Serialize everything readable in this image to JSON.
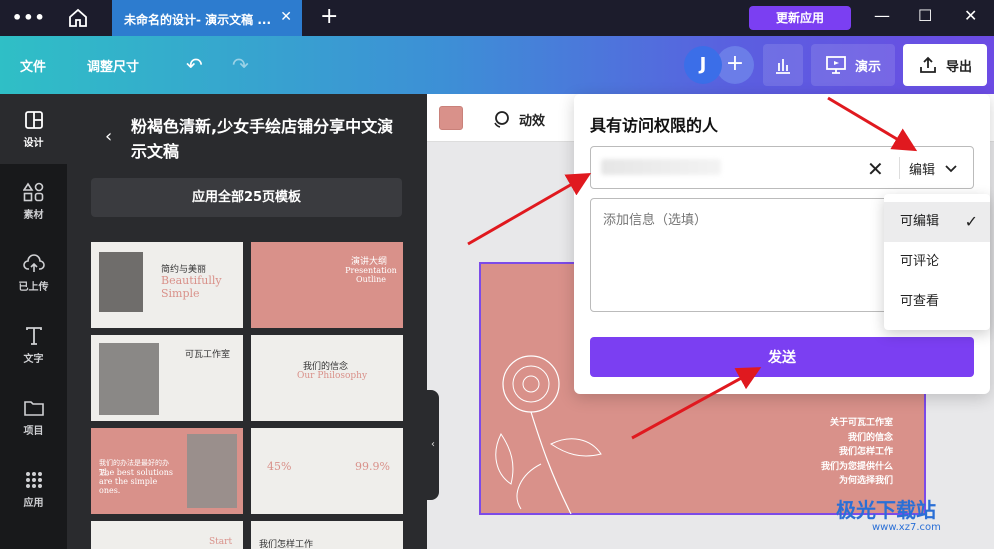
{
  "titlebar": {
    "tab_title": "未命名的设计- 演示文稿 ...",
    "update_label": "更新应用"
  },
  "toolbar": {
    "file_label": "文件",
    "resize_label": "调整尺寸",
    "avatar_initial": "J",
    "present_label": "演示",
    "export_label": "导出"
  },
  "leftnav": {
    "items": [
      {
        "label": "设计",
        "icon": "layout-icon"
      },
      {
        "label": "素材",
        "icon": "shapes-icon"
      },
      {
        "label": "已上传",
        "icon": "upload-icon"
      },
      {
        "label": "文字",
        "icon": "text-icon"
      },
      {
        "label": "项目",
        "icon": "folder-icon"
      },
      {
        "label": "应用",
        "icon": "apps-icon"
      }
    ]
  },
  "panel": {
    "title": "粉褐色清新,少女手绘店铺分享中文演示文稿",
    "apply_all_label": "应用全部25页模板",
    "thumbs": [
      {
        "t1": "简约与美丽",
        "t2": "Beautifully Simple"
      },
      {
        "t1": "演讲大纲",
        "t2": "Presentation Outline"
      },
      {
        "t1": "可瓦工作室",
        "t2": ""
      },
      {
        "t1": "我们的信念",
        "t2": "Our Philosophy"
      },
      {
        "t1": "我们的办法是最好的办法。",
        "t2": "The best solutions are the simple ones."
      },
      {
        "t1": "45%",
        "t2": "99.9%"
      },
      {
        "t1": "Start",
        "t2": ""
      },
      {
        "t1": "我们怎样工作",
        "t2": ""
      }
    ]
  },
  "context_bar": {
    "animate_label": "动效",
    "swatch_color": "#d9918a"
  },
  "slide": {
    "lines": [
      "关于可瓦工作室",
      "我们的信念",
      "我们怎样工作",
      "我们为您提供什么",
      "为何选择我们"
    ]
  },
  "share": {
    "title": "具有访问权限的人",
    "role_label": "编辑",
    "message_placeholder": "添加信息（选填）",
    "send_label": "发送"
  },
  "role_dropdown": {
    "options": [
      "可编辑",
      "可评论",
      "可查看"
    ],
    "selected": "可编辑"
  },
  "watermark": {
    "text": "极光下载站",
    "sub": "www.xz7.com"
  }
}
